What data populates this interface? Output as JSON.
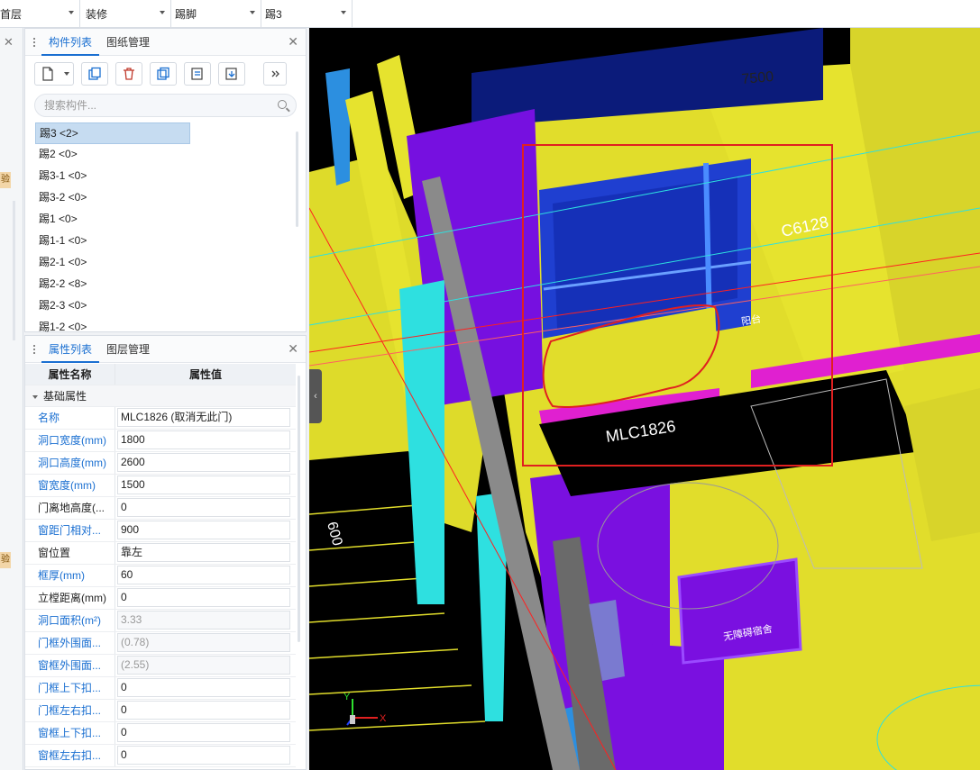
{
  "toolbar": {
    "floor": "首层",
    "category": "装修",
    "type": "踢脚",
    "item": "踢3"
  },
  "left_strip": {
    "tag1": "验",
    "tag2": "验"
  },
  "component_panel": {
    "tabs": [
      "构件列表",
      "图纸管理"
    ],
    "search_placeholder": "搜索构件...",
    "items": [
      "踢3 <2>",
      "踢2 <0>",
      "踢3-1 <0>",
      "踢3-2 <0>",
      "踢1 <0>",
      "踢1-1 <0>",
      "踢2-1 <0>",
      "踢2-2 <8>",
      "踢2-3 <0>",
      "踢1-2 <0>"
    ]
  },
  "property_panel": {
    "tabs": [
      "属性列表",
      "图层管理"
    ],
    "col_name": "属性名称",
    "col_value": "属性值",
    "group": "基础属性",
    "rows": [
      {
        "name": "名称",
        "value": "MLC1826 (取消无此门)"
      },
      {
        "name": "洞口宽度(mm)",
        "value": "1800"
      },
      {
        "name": "洞口高度(mm)",
        "value": "2600"
      },
      {
        "name": "窗宽度(mm)",
        "value": "1500"
      },
      {
        "name": "门离地高度(...",
        "value": "0"
      },
      {
        "name": "窗距门相对...",
        "value": "900"
      },
      {
        "name": "窗位置",
        "value": "靠左"
      },
      {
        "name": "框厚(mm)",
        "value": "60"
      },
      {
        "name": "立樘距离(mm)",
        "value": "0"
      },
      {
        "name": "洞口面积(m²)",
        "value": "3.33"
      },
      {
        "name": "门框外围面...",
        "value": "(0.78)"
      },
      {
        "name": "窗框外围面...",
        "value": "(2.55)"
      },
      {
        "name": "门框上下扣...",
        "value": "0"
      },
      {
        "name": "门框左右扣...",
        "value": "0"
      },
      {
        "name": "窗框上下扣...",
        "value": "0"
      },
      {
        "name": "窗框左右扣...",
        "value": "0"
      }
    ]
  },
  "viewport": {
    "dim_top": "7500",
    "dim_left": "600",
    "window_label": "C6128",
    "door_label": "MLC1826",
    "room_label": "阳台",
    "sign_label": "无障碍宿舍",
    "axis_x": "X",
    "axis_y": "Y"
  },
  "colors": {
    "accent": "#1a6fd1",
    "yellow": "#e1dd2b",
    "purple": "#7a10e0",
    "cyan": "#2ee0e0",
    "blue": "#1f3fd0",
    "red": "#e02020"
  }
}
